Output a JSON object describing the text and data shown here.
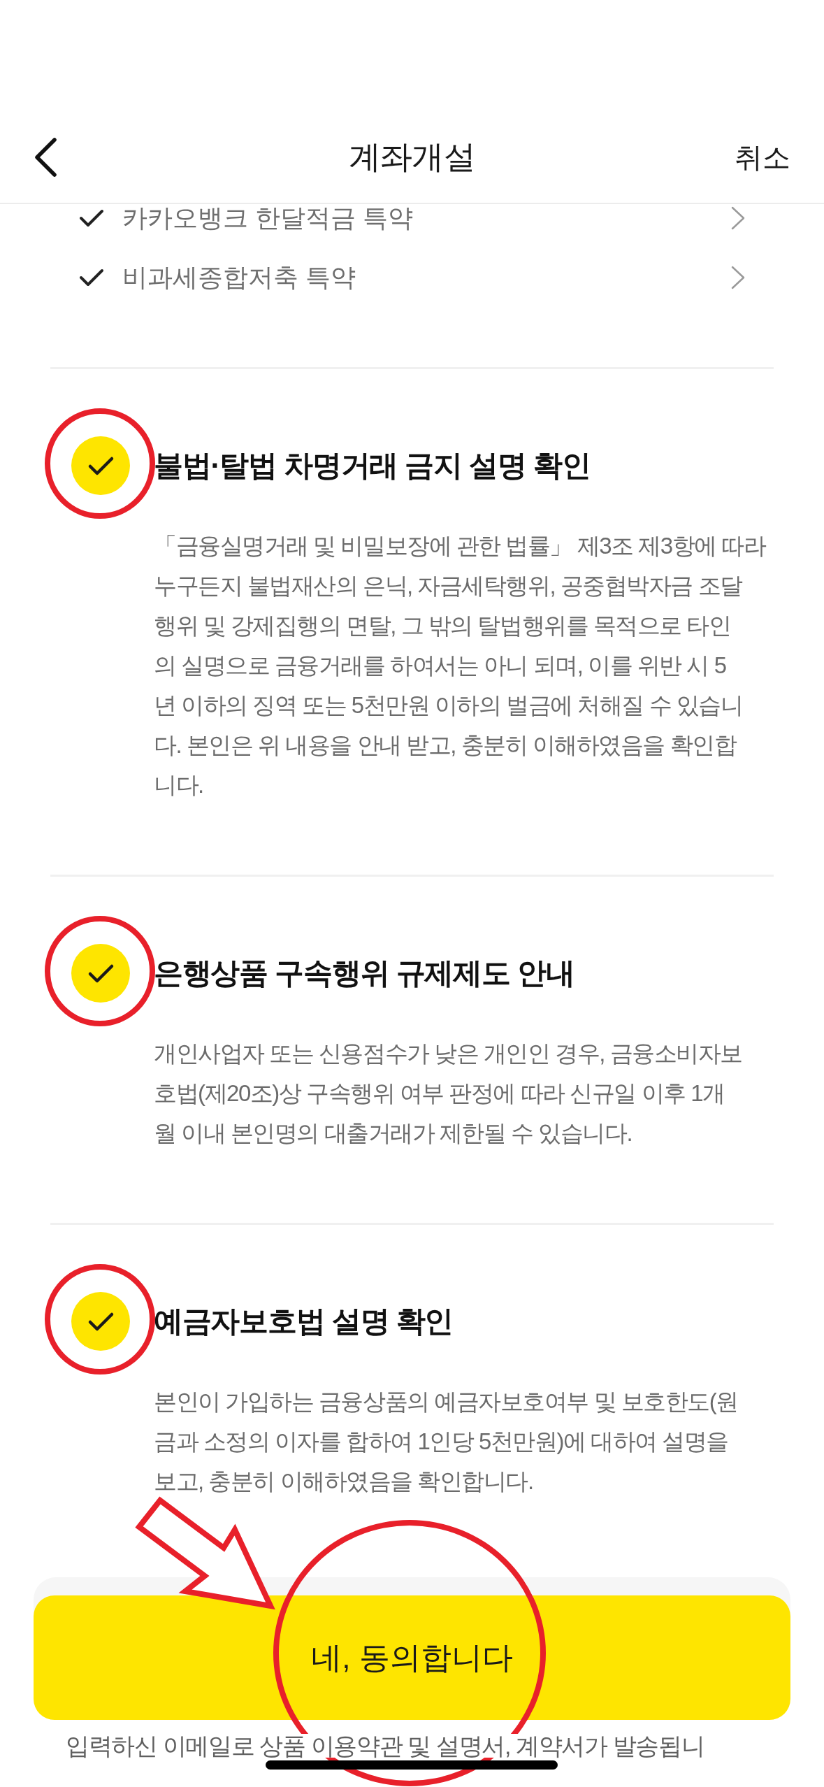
{
  "header": {
    "title": "계좌개설",
    "cancel": "취소"
  },
  "agreements": [
    {
      "label": "카카오뱅크 한달적금 특약",
      "checked": true
    },
    {
      "label": "비과세종합저축 특약",
      "checked": true
    }
  ],
  "sections": [
    {
      "title": "불법·탈법 차명거래 금지 설명 확인",
      "checked": true,
      "highlighted": true,
      "body": [
        "「금융실명거래 및 비밀보장에 관한 법률」 제3조 제3항에 따라",
        "누구든지 불법재산의 은닉, 자금세탁행위, 공중협박자금 조달",
        "행위 및 강제집행의 면탈, 그 밖의 탈법행위를 목적으로 타인",
        "의 실명으로 금융거래를 하여서는 아니 되며, 이를 위반 시 5",
        "년 이하의 징역 또는 5천만원 이하의 벌금에 처해질 수 있습니",
        "다. 본인은 위 내용을 안내 받고, 충분히 이해하였음을 확인합",
        "니다."
      ]
    },
    {
      "title": "은행상품 구속행위 규제제도 안내",
      "checked": true,
      "highlighted": true,
      "body": [
        "개인사업자 또는 신용점수가 낮은 개인인 경우, 금융소비자보",
        "호법(제20조)상 구속행위 여부 판정에 따라 신규일 이후 1개",
        "월 이내 본인명의 대출거래가 제한될 수 있습니다."
      ]
    },
    {
      "title": "예금자보호법 설명 확인",
      "checked": true,
      "highlighted": true,
      "body": [
        "본인이 가입하는 금융상품의 예금자보호여부 및 보호한도(원",
        "금과 소정의 이자를 합하여 1인당 5천만원)에 대하여 설명을",
        "보고, 충분히 이해하였음을 확인합니다."
      ]
    }
  ],
  "confirm_button": {
    "label": "네, 동의합니다",
    "highlighted": true,
    "pointed": true
  },
  "notice": "입력하신 이메일로 상품 이용약관 및 설명서, 계약서가 발송됩니"
}
